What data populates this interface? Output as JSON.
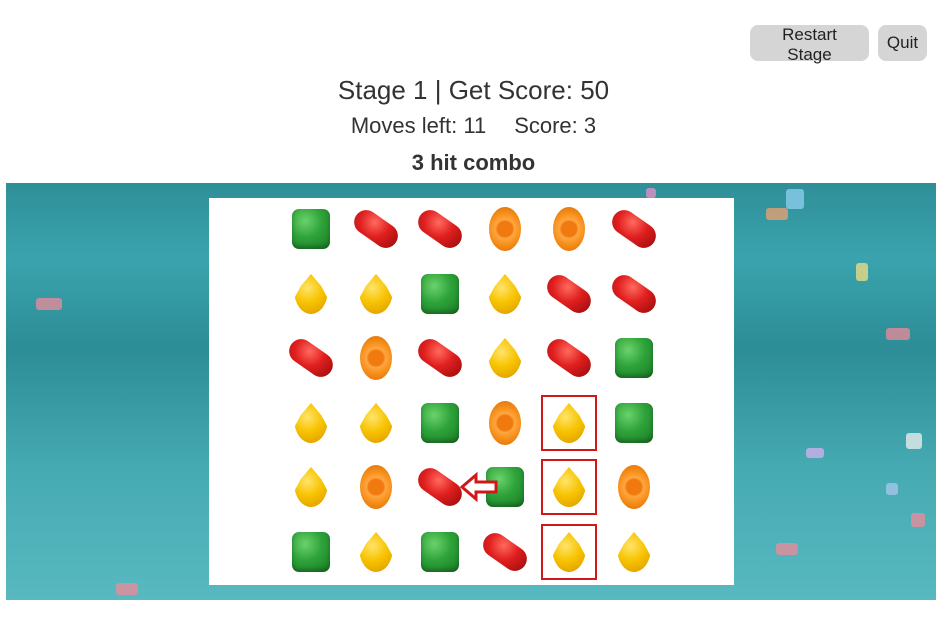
{
  "controls": {
    "restart_label": "Restart Stage",
    "quit_label": "Quit"
  },
  "header": {
    "stage_title": "Stage 1 | Get Score: 50",
    "moves_text": "Moves left: 11",
    "score_text": "Score: 3",
    "combo_text": "3 hit combo"
  },
  "board": {
    "rows": 6,
    "cols": 6,
    "candies": [
      [
        "green",
        "red",
        "red",
        "orange",
        "orange",
        "red"
      ],
      [
        "yellow",
        "yellow",
        "green",
        "yellow",
        "red",
        "red"
      ],
      [
        "red",
        "orange",
        "red",
        "yellow",
        "red",
        "green"
      ],
      [
        "yellow",
        "yellow",
        "green",
        "orange",
        "yellow",
        "green"
      ],
      [
        "yellow",
        "orange",
        "red",
        "green",
        "yellow",
        "orange"
      ],
      [
        "green",
        "yellow",
        "green",
        "red",
        "yellow",
        "yellow"
      ]
    ],
    "highlighted": [
      [
        3,
        4
      ],
      [
        4,
        4
      ],
      [
        5,
        4
      ]
    ],
    "swap_hint": {
      "from": [
        4,
        3
      ],
      "to": [
        4,
        2
      ],
      "direction": "left"
    }
  },
  "colors": {
    "highlight": "#d01818",
    "button_bg": "#d5d5d5",
    "background_teal": "#3aa3ad"
  }
}
